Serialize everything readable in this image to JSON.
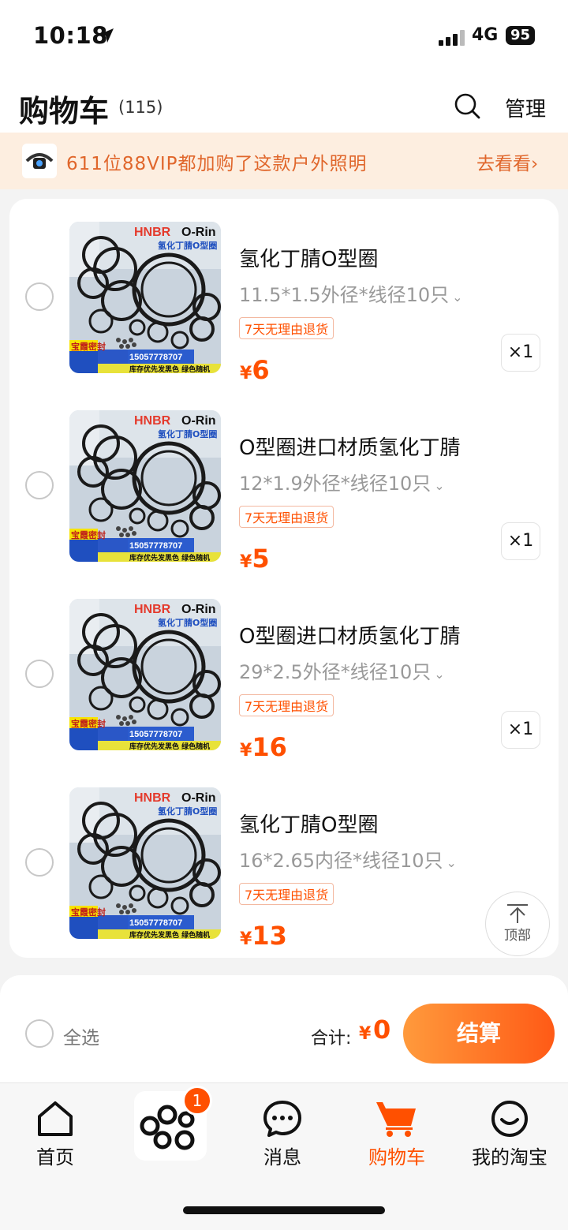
{
  "status_bar": {
    "time": "10:18",
    "network": "4G",
    "battery": "95"
  },
  "header": {
    "title": "购物车",
    "count": "(115)",
    "manage_label": "管理"
  },
  "promo": {
    "text": "611位88VIP都加购了这款户外照明",
    "link": "去看看›"
  },
  "product_image_text": {
    "brand": "HNBR",
    "type": "O-Rin",
    "subtitle": "氢化丁腈O型圈",
    "shop": "宝霞密封",
    "phone": "15057778707",
    "footer": "库存优先发黑色 绿色随机"
  },
  "cart_items": [
    {
      "title": "氢化丁腈O型圈",
      "spec": "11.5*1.5外径*线径10只",
      "tag": "7天无理由退货",
      "currency": "¥",
      "price": "6",
      "qty": "×1"
    },
    {
      "title": "O型圈进口材质氢化丁腈",
      "spec": "12*1.9外径*线径10只",
      "tag": "7天无理由退货",
      "currency": "¥",
      "price": "5",
      "qty": "×1"
    },
    {
      "title": "O型圈进口材质氢化丁腈",
      "spec": "29*2.5外径*线径10只",
      "tag": "7天无理由退货",
      "currency": "¥",
      "price": "16",
      "qty": "×1"
    },
    {
      "title": "氢化丁腈O型圈",
      "spec": "16*2.65内径*线径10只",
      "tag": "7天无理由退货",
      "currency": "¥",
      "price": "13",
      "qty": ""
    }
  ],
  "back_to_top": "顶部",
  "checkout": {
    "select_all": "全选",
    "total_label": "合计:",
    "currency": "¥",
    "total": "0",
    "pay_label": "结算"
  },
  "tabbar": {
    "home": "首页",
    "messages": "消息",
    "cart": "购物车",
    "mine": "我的淘宝",
    "badge": "1"
  },
  "colors": {
    "accent": "#ff5000",
    "promo_bg": "#fdeee0",
    "promo_text": "#e0662b"
  }
}
